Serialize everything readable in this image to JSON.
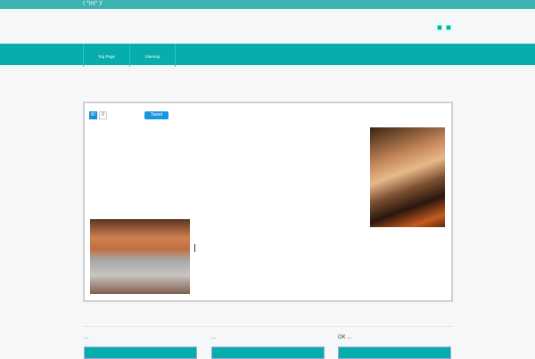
{
  "site": {
    "tagline": "( ^)o(^ )/"
  },
  "nav": {
    "items": [
      {
        "label": "Top Page"
      },
      {
        "label": "Sitemap"
      }
    ]
  },
  "share": {
    "hatena_label": "B!",
    "hatena_count": "0",
    "tweet_label": "Tweet"
  },
  "columns": [
    {
      "title": "..."
    },
    {
      "title": "..."
    },
    {
      "title": "OK ..."
    }
  ],
  "colors": {
    "accent": "#06adab",
    "topbar": "#3bb3b1"
  }
}
